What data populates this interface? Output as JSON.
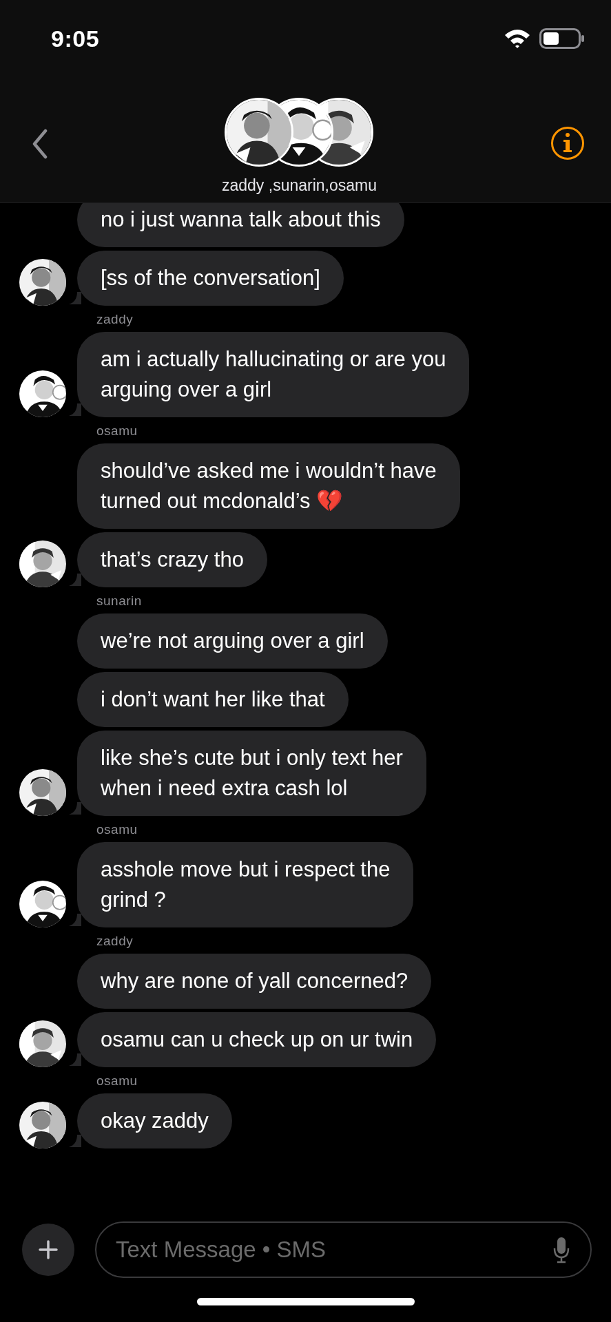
{
  "status_bar": {
    "time": "9:05"
  },
  "header": {
    "title": "zaddy ,sunarin,osamu"
  },
  "messages": [
    {
      "lines": [
        "no i just wanna talk about this"
      ],
      "avatar": false,
      "cut": true
    },
    {
      "lines": [
        "[ss of the conversation]"
      ],
      "avatar": true
    },
    {
      "sender": "zaddy",
      "lines": [
        "am i actually hallucinating or are you",
        "arguing over a girl"
      ],
      "avatar": true
    },
    {
      "sender": "osamu",
      "lines": [
        "should’ve asked me i wouldn’t have",
        "turned out mcdonald’s 💔"
      ],
      "avatar": false
    },
    {
      "lines": [
        "that’s crazy tho"
      ],
      "avatar": true
    },
    {
      "sender": "sunarin",
      "lines": [
        "we’re not arguing over a girl"
      ],
      "avatar": false
    },
    {
      "lines": [
        "i don’t want her like that"
      ],
      "avatar": false
    },
    {
      "lines": [
        "like she’s cute but i only text her",
        "when i need extra cash lol"
      ],
      "avatar": true
    },
    {
      "sender": "osamu",
      "lines": [
        "asshole move but i respect the",
        "grind ?"
      ],
      "avatar": true
    },
    {
      "sender": "zaddy",
      "lines": [
        "why are none of yall concerned?"
      ],
      "avatar": false
    },
    {
      "lines": [
        "osamu can u check up on ur twin"
      ],
      "avatar": true
    },
    {
      "sender": "osamu",
      "lines": [
        "okay zaddy"
      ],
      "avatar": true
    }
  ],
  "composer": {
    "placeholder": "Text Message • SMS"
  }
}
